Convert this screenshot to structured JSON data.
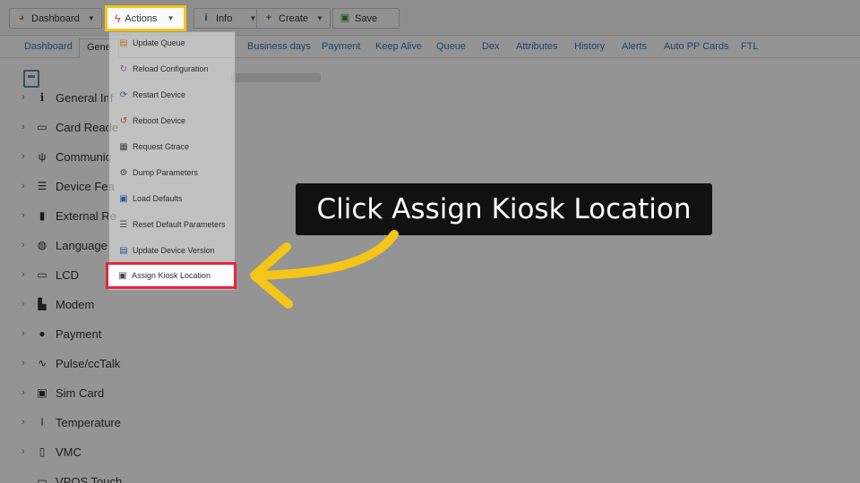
{
  "toolbar": {
    "dashboard_label": "Dashboard",
    "actions_label": "Actions",
    "info_label": "Info",
    "create_label": "Create",
    "save_label": "Save"
  },
  "tabs": [
    {
      "label": "Dashboard"
    },
    {
      "label": "Gene"
    },
    {
      "label": "Business days"
    },
    {
      "label": "Payment"
    },
    {
      "label": "Keep Alive"
    },
    {
      "label": "Queue"
    },
    {
      "label": "Dex"
    },
    {
      "label": "Attributes"
    },
    {
      "label": "History"
    },
    {
      "label": "Alerts"
    },
    {
      "label": "Auto PP Cards"
    },
    {
      "label": "FTL"
    }
  ],
  "tree": [
    {
      "label": "General Inf",
      "icon": "info-icon"
    },
    {
      "label": "Card Reade",
      "icon": "card-reader-icon"
    },
    {
      "label": "Communic",
      "icon": "antenna-icon"
    },
    {
      "label": "Device Fea",
      "icon": "features-icon"
    },
    {
      "label": "External Re",
      "icon": "external-device-icon"
    },
    {
      "label": "Language",
      "icon": "globe-icon"
    },
    {
      "label": "LCD",
      "icon": "lcd-icon"
    },
    {
      "label": "Modem",
      "icon": "modem-icon"
    },
    {
      "label": "Payment",
      "icon": "payment-icon"
    },
    {
      "label": "Pulse/ccTalk",
      "icon": "pulse-icon"
    },
    {
      "label": "Sim Card",
      "icon": "sim-card-icon"
    },
    {
      "label": "Temperature",
      "icon": "thermometer-icon"
    },
    {
      "label": "VMC",
      "icon": "vmc-icon"
    },
    {
      "label": "VPOS Touch",
      "icon": "vpos-icon"
    }
  ],
  "actions_menu": [
    {
      "label": "Update Queue",
      "icon": "queue-icon"
    },
    {
      "label": "Reload Configuration",
      "icon": "reload-icon"
    },
    {
      "label": "Restart Device",
      "icon": "restart-icon"
    },
    {
      "label": "Reboot Device",
      "icon": "reboot-icon"
    },
    {
      "label": "Request Gtrace",
      "icon": "trace-icon"
    },
    {
      "label": "Dump Parameters",
      "icon": "dump-icon"
    },
    {
      "label": "Load Defaults",
      "icon": "load-defaults-icon"
    },
    {
      "label": "Reset Default Parameters",
      "icon": "reset-icon"
    },
    {
      "label": "Update Device Version",
      "icon": "update-version-icon"
    },
    {
      "label": "Assign Kiosk Location",
      "icon": "kiosk-icon"
    }
  ],
  "callout": {
    "text": "Click Assign Kiosk Location"
  },
  "colors": {
    "highlight_actions": "#f5c518",
    "highlight_item": "#e8253f",
    "arrow": "#f5c518",
    "callout_bg": "#111111"
  }
}
